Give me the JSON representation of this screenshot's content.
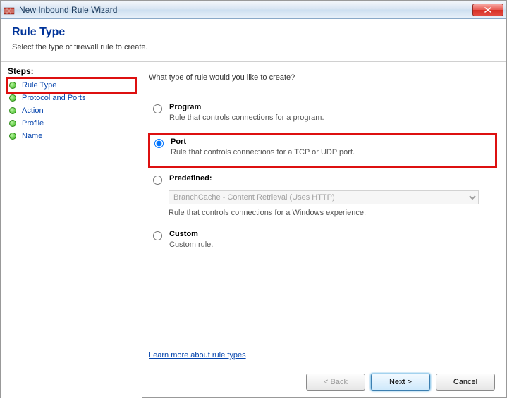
{
  "window": {
    "title": "New Inbound Rule Wizard"
  },
  "header": {
    "title": "Rule Type",
    "subtitle": "Select the type of firewall rule to create."
  },
  "sidebar": {
    "label": "Steps:",
    "items": [
      {
        "label": "Rule Type"
      },
      {
        "label": "Protocol and Ports"
      },
      {
        "label": "Action"
      },
      {
        "label": "Profile"
      },
      {
        "label": "Name"
      }
    ]
  },
  "main": {
    "prompt": "What type of rule would you like to create?",
    "options": {
      "program": {
        "title": "Program",
        "desc": "Rule that controls connections for a program."
      },
      "port": {
        "title": "Port",
        "desc": "Rule that controls connections for a TCP or UDP port."
      },
      "predefined": {
        "title": "Predefined:",
        "desc": "Rule that controls connections for a Windows experience.",
        "selected": "BranchCache - Content Retrieval (Uses HTTP)"
      },
      "custom": {
        "title": "Custom",
        "desc": "Custom rule."
      }
    },
    "learn_link": "Learn more about rule types"
  },
  "buttons": {
    "back": "< Back",
    "next": "Next >",
    "cancel": "Cancel"
  },
  "selected_option": "port"
}
